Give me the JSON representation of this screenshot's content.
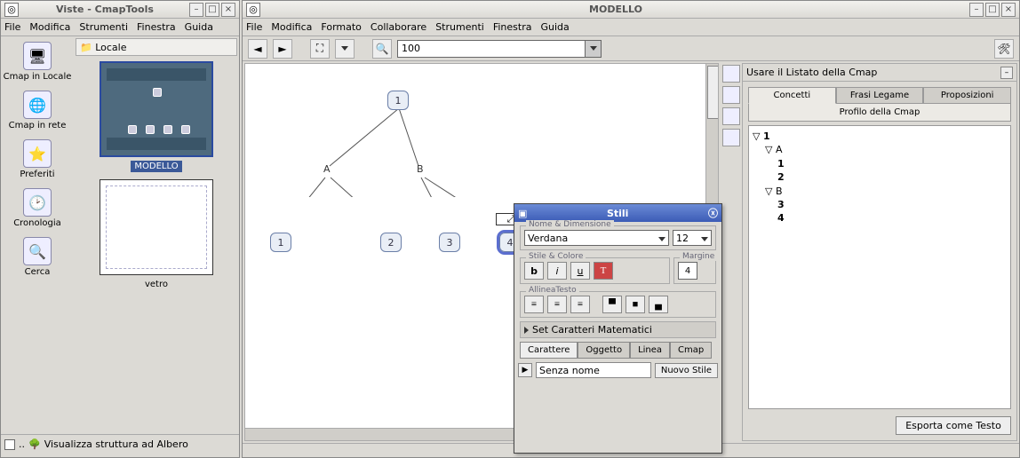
{
  "viste": {
    "title": "Viste - CmapTools",
    "menu": [
      "File",
      "Modifica",
      "Strumenti",
      "Finestra",
      "Guida"
    ],
    "nav": [
      {
        "label": "Cmap in Locale"
      },
      {
        "label": "Cmap in rete"
      },
      {
        "label": "Preferiti"
      },
      {
        "label": "Cronologia"
      },
      {
        "label": "Cerca"
      }
    ],
    "locale_label": "Locale",
    "thumbs": [
      {
        "label": "MODELLO",
        "selected": true
      },
      {
        "label": "vetro",
        "selected": false
      }
    ],
    "status": "Visualizza struttura ad Albero"
  },
  "modello": {
    "title": "MODELLO",
    "menu": [
      "File",
      "Modifica",
      "Formato",
      "Collaborare",
      "Strumenti",
      "Finestra",
      "Guida"
    ],
    "zoom": "100",
    "nodes": {
      "1a": "1",
      "A": "A",
      "B": "B",
      "n1": "1",
      "n2": "2",
      "n3": "3",
      "n4": "4"
    },
    "listato": {
      "title": "Usare il Listato della Cmap",
      "tabs": [
        "Concetti",
        "Frasi Legame",
        "Proposizioni"
      ],
      "subtitle": "Profilo della Cmap",
      "tree": [
        {
          "level": 0,
          "exp": true,
          "bold": true,
          "t": "1"
        },
        {
          "level": 1,
          "exp": true,
          "bold": false,
          "t": "A"
        },
        {
          "level": 2,
          "exp": false,
          "bold": true,
          "t": "1"
        },
        {
          "level": 2,
          "exp": false,
          "bold": true,
          "t": "2"
        },
        {
          "level": 1,
          "exp": true,
          "bold": false,
          "t": "B"
        },
        {
          "level": 2,
          "exp": false,
          "bold": true,
          "t": "3"
        },
        {
          "level": 2,
          "exp": false,
          "bold": true,
          "t": "4"
        }
      ],
      "export": "Esporta come Testo"
    }
  },
  "stili": {
    "title": "Stili",
    "sec_name_dim": "Nome & Dimensione",
    "font": "Verdana",
    "size": "12",
    "sec_style_color": "Stile & Colore",
    "margin_label": "Margine",
    "margin_val": "4",
    "sec_align": "AllineaTesto",
    "expander": "Set Caratteri Matematici",
    "btabs": [
      "Carattere",
      "Oggetto",
      "Linea",
      "Cmap"
    ],
    "stylename": "Senza nome",
    "newstyle": "Nuovo Stile"
  }
}
